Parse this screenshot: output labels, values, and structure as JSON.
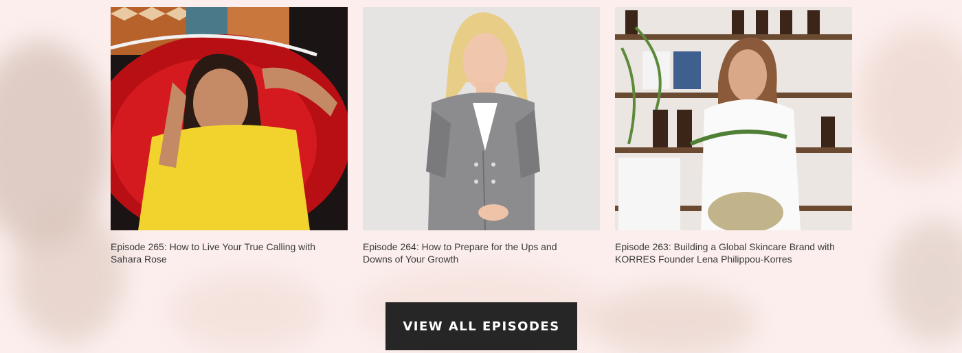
{
  "episodes": [
    {
      "title": "Episode 265: How to Live Your True Calling with Sahara Rose",
      "image": "woman-in-yellow-dress-red-chair"
    },
    {
      "title": "Episode 264: How to Prepare for the Ups and Downs of Your Growth",
      "image": "woman-in-silver-blazer"
    },
    {
      "title": "Episode 263: Building a Global Skincare Brand with KORRES Founder Lena Philippou-Korres",
      "image": "woman-in-lab-coat-apothecary"
    }
  ],
  "cta": {
    "label": "VIEW ALL EPISODES"
  },
  "colors": {
    "background": "#fbeeec",
    "button": "#262626",
    "button_text": "#ffffff",
    "title_text": "#3a3a3a"
  }
}
